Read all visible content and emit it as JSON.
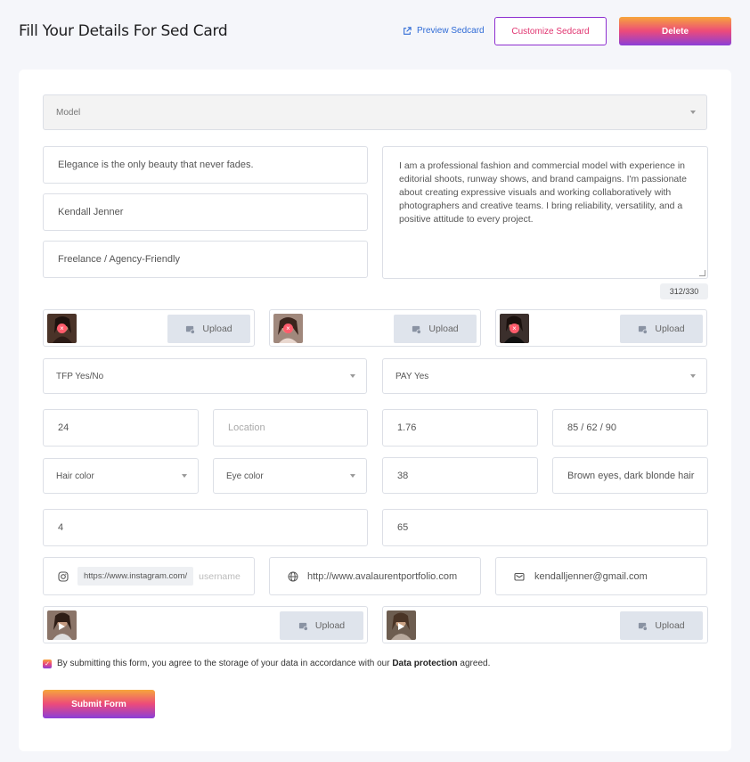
{
  "header": {
    "title": "Fill Your Details For Sed Card",
    "preview_label": "Preview Sedcard",
    "customize_label": "Customize Sedcard",
    "delete_label": "Delete"
  },
  "form": {
    "category": "Model",
    "motto": "Elegance is the only beauty that never fades.",
    "name": "Kendall Jenner",
    "work_type": "Freelance / Agency-Friendly",
    "bio": "I am a professional fashion and commercial model with experience in editorial shoots, runway shows, and brand campaigns. I'm passionate about creating expressive visuals and working collaboratively with photographers and creative teams. I bring reliability, versatility, and a positive attitude to every project.",
    "bio_counter": "312/330",
    "upload_label": "Upload",
    "tfp": "TFP Yes/No",
    "pay": "PAY Yes",
    "age": "24",
    "location_placeholder": "Location",
    "height": "1.76",
    "measurements": "85 / 62 / 90",
    "hair_color": "Hair color",
    "eye_color": "Eye color",
    "shoe_size": "38",
    "appearance": "Brown eyes, dark blonde hair",
    "field_a": "4",
    "field_b": "65",
    "instagram_prefix": "https://www.instagram.com/",
    "instagram_placeholder": "username",
    "website": "http://www.avalaurentportfolio.com",
    "email": "kendalljenner@gmail.com",
    "consent_before": "By submitting this form, you agree to the storage of your data in accordance with our ",
    "consent_link": "Data protection",
    "consent_after": " agreed.",
    "submit_label": "Submit Form"
  },
  "colors": {
    "gradient_start": "#f7a63b",
    "gradient_mid": "#ec4a7b",
    "gradient_end": "#8a3fd8",
    "link_blue": "#2f6bd6"
  }
}
